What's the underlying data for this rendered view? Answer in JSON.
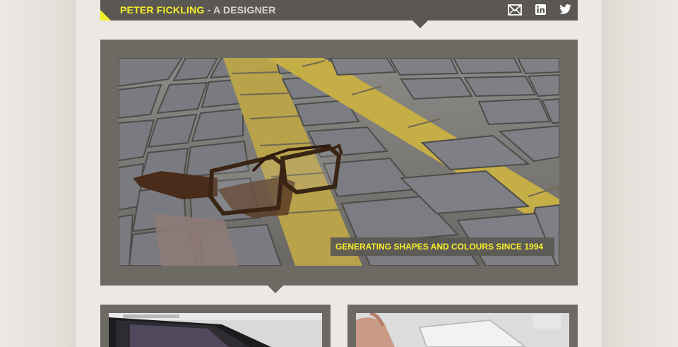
{
  "header": {
    "name": "PETER FICKLING",
    "role": " - A DESIGNER",
    "social": [
      {
        "icon": "mail-icon",
        "label": "Email"
      },
      {
        "icon": "linkedin-icon",
        "label": "LinkedIn"
      },
      {
        "icon": "twitter-icon",
        "label": "Twitter"
      }
    ]
  },
  "hero": {
    "caption": "GENERATING SHAPES AND COLOURS SINCE 1994"
  },
  "colors": {
    "accent": "#f5ef2a",
    "panel": "#6d6a64",
    "header": "#5b5853",
    "page": "#ece9e4"
  }
}
